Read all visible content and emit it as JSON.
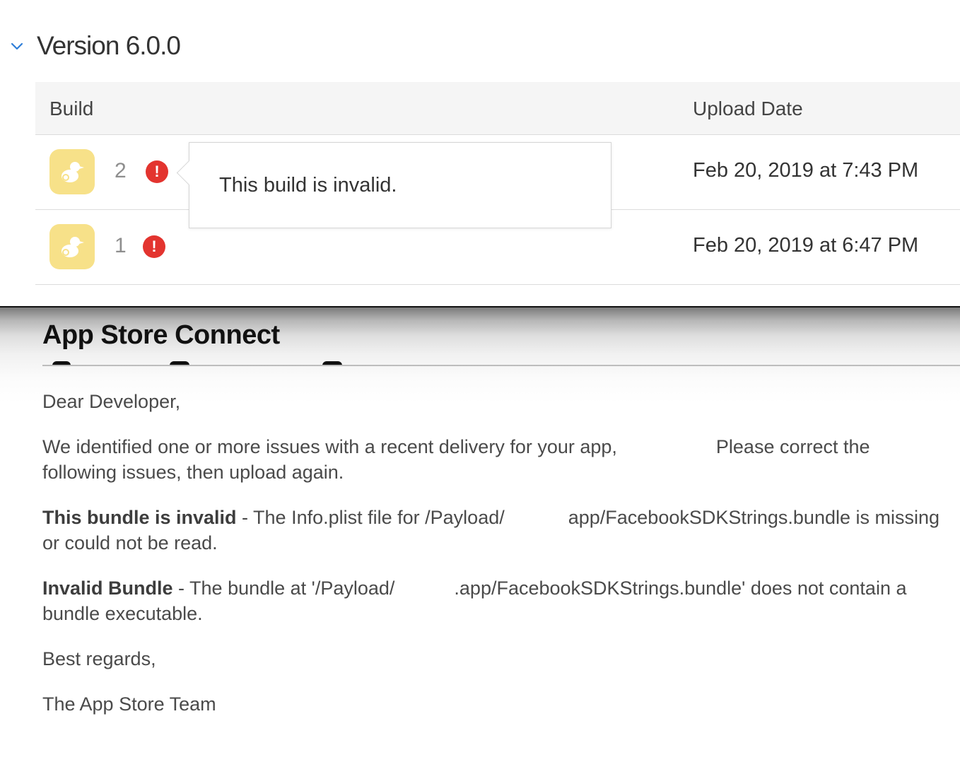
{
  "version_section": {
    "title": "Version 6.0.0"
  },
  "table": {
    "headers": {
      "build": "Build",
      "upload_date": "Upload Date"
    },
    "rows": [
      {
        "build_number": "2",
        "upload_date": "Feb 20, 2019 at 7:43 PM",
        "status": "invalid"
      },
      {
        "build_number": "1",
        "upload_date": "Feb 20, 2019 at 6:47 PM",
        "status": "invalid"
      }
    ],
    "error_glyph": "!"
  },
  "tooltip": {
    "text": "This build is invalid."
  },
  "email": {
    "title": "App Store Connect",
    "greeting": "Dear Developer,",
    "intro_part1": "We identified one or more issues with a recent delivery for your app,",
    "intro_part2": "Please correct the following issues, then upload again.",
    "issue1_heading": "This bundle is invalid",
    "issue1_part1": " - The Info.plist file for /Payload/",
    "issue1_part2": "app/FacebookSDKStrings.bundle is missing or could not be read.",
    "issue2_heading": "Invalid Bundle",
    "issue2_part1": " - The bundle at '/Payload/",
    "issue2_part2": ".app/FacebookSDKStrings.bundle' does not contain a bundle executable.",
    "closing": "Best regards,",
    "signature": "The App Store Team"
  },
  "colors": {
    "accent_blue": "#2f7fd8",
    "error_red": "#e3342f",
    "app_icon_bg": "#f7e189"
  },
  "icons": {
    "chevron": "chevron-down-icon",
    "app": "duck-app-icon",
    "error": "exclamation-circle-icon"
  }
}
